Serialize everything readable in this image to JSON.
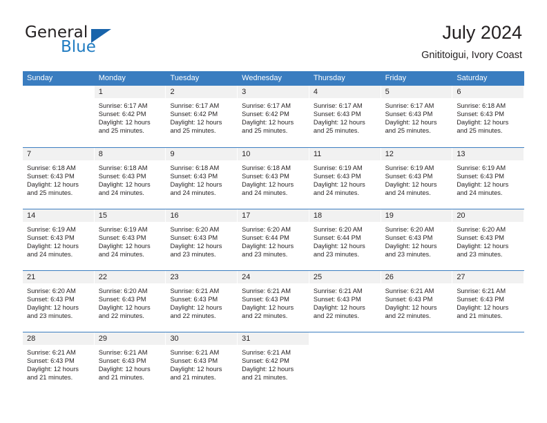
{
  "brand": {
    "word_general": "General",
    "word_blue": "Blue",
    "triangle_color": "#1864ab",
    "blue_color": "#1f7bc1"
  },
  "header": {
    "title": "July 2024",
    "subtitle": "Gnititoigui, Ivory Coast"
  },
  "theme": {
    "header_band": "#3a7dc0",
    "day_head_bg": "#f1f1f1",
    "text": "#231f20"
  },
  "weekday_headers": [
    "Sunday",
    "Monday",
    "Tuesday",
    "Wednesday",
    "Thursday",
    "Friday",
    "Saturday"
  ],
  "weeks": [
    [
      {
        "day": "",
        "lines": []
      },
      {
        "day": "1",
        "lines": [
          "Sunrise: 6:17 AM",
          "Sunset: 6:42 PM",
          "Daylight: 12 hours",
          "and 25 minutes."
        ]
      },
      {
        "day": "2",
        "lines": [
          "Sunrise: 6:17 AM",
          "Sunset: 6:42 PM",
          "Daylight: 12 hours",
          "and 25 minutes."
        ]
      },
      {
        "day": "3",
        "lines": [
          "Sunrise: 6:17 AM",
          "Sunset: 6:42 PM",
          "Daylight: 12 hours",
          "and 25 minutes."
        ]
      },
      {
        "day": "4",
        "lines": [
          "Sunrise: 6:17 AM",
          "Sunset: 6:43 PM",
          "Daylight: 12 hours",
          "and 25 minutes."
        ]
      },
      {
        "day": "5",
        "lines": [
          "Sunrise: 6:17 AM",
          "Sunset: 6:43 PM",
          "Daylight: 12 hours",
          "and 25 minutes."
        ]
      },
      {
        "day": "6",
        "lines": [
          "Sunrise: 6:18 AM",
          "Sunset: 6:43 PM",
          "Daylight: 12 hours",
          "and 25 minutes."
        ]
      }
    ],
    [
      {
        "day": "7",
        "lines": [
          "Sunrise: 6:18 AM",
          "Sunset: 6:43 PM",
          "Daylight: 12 hours",
          "and 25 minutes."
        ]
      },
      {
        "day": "8",
        "lines": [
          "Sunrise: 6:18 AM",
          "Sunset: 6:43 PM",
          "Daylight: 12 hours",
          "and 24 minutes."
        ]
      },
      {
        "day": "9",
        "lines": [
          "Sunrise: 6:18 AM",
          "Sunset: 6:43 PM",
          "Daylight: 12 hours",
          "and 24 minutes."
        ]
      },
      {
        "day": "10",
        "lines": [
          "Sunrise: 6:18 AM",
          "Sunset: 6:43 PM",
          "Daylight: 12 hours",
          "and 24 minutes."
        ]
      },
      {
        "day": "11",
        "lines": [
          "Sunrise: 6:19 AM",
          "Sunset: 6:43 PM",
          "Daylight: 12 hours",
          "and 24 minutes."
        ]
      },
      {
        "day": "12",
        "lines": [
          "Sunrise: 6:19 AM",
          "Sunset: 6:43 PM",
          "Daylight: 12 hours",
          "and 24 minutes."
        ]
      },
      {
        "day": "13",
        "lines": [
          "Sunrise: 6:19 AM",
          "Sunset: 6:43 PM",
          "Daylight: 12 hours",
          "and 24 minutes."
        ]
      }
    ],
    [
      {
        "day": "14",
        "lines": [
          "Sunrise: 6:19 AM",
          "Sunset: 6:43 PM",
          "Daylight: 12 hours",
          "and 24 minutes."
        ]
      },
      {
        "day": "15",
        "lines": [
          "Sunrise: 6:19 AM",
          "Sunset: 6:43 PM",
          "Daylight: 12 hours",
          "and 24 minutes."
        ]
      },
      {
        "day": "16",
        "lines": [
          "Sunrise: 6:20 AM",
          "Sunset: 6:43 PM",
          "Daylight: 12 hours",
          "and 23 minutes."
        ]
      },
      {
        "day": "17",
        "lines": [
          "Sunrise: 6:20 AM",
          "Sunset: 6:44 PM",
          "Daylight: 12 hours",
          "and 23 minutes."
        ]
      },
      {
        "day": "18",
        "lines": [
          "Sunrise: 6:20 AM",
          "Sunset: 6:44 PM",
          "Daylight: 12 hours",
          "and 23 minutes."
        ]
      },
      {
        "day": "19",
        "lines": [
          "Sunrise: 6:20 AM",
          "Sunset: 6:43 PM",
          "Daylight: 12 hours",
          "and 23 minutes."
        ]
      },
      {
        "day": "20",
        "lines": [
          "Sunrise: 6:20 AM",
          "Sunset: 6:43 PM",
          "Daylight: 12 hours",
          "and 23 minutes."
        ]
      }
    ],
    [
      {
        "day": "21",
        "lines": [
          "Sunrise: 6:20 AM",
          "Sunset: 6:43 PM",
          "Daylight: 12 hours",
          "and 23 minutes."
        ]
      },
      {
        "day": "22",
        "lines": [
          "Sunrise: 6:20 AM",
          "Sunset: 6:43 PM",
          "Daylight: 12 hours",
          "and 22 minutes."
        ]
      },
      {
        "day": "23",
        "lines": [
          "Sunrise: 6:21 AM",
          "Sunset: 6:43 PM",
          "Daylight: 12 hours",
          "and 22 minutes."
        ]
      },
      {
        "day": "24",
        "lines": [
          "Sunrise: 6:21 AM",
          "Sunset: 6:43 PM",
          "Daylight: 12 hours",
          "and 22 minutes."
        ]
      },
      {
        "day": "25",
        "lines": [
          "Sunrise: 6:21 AM",
          "Sunset: 6:43 PM",
          "Daylight: 12 hours",
          "and 22 minutes."
        ]
      },
      {
        "day": "26",
        "lines": [
          "Sunrise: 6:21 AM",
          "Sunset: 6:43 PM",
          "Daylight: 12 hours",
          "and 22 minutes."
        ]
      },
      {
        "day": "27",
        "lines": [
          "Sunrise: 6:21 AM",
          "Sunset: 6:43 PM",
          "Daylight: 12 hours",
          "and 21 minutes."
        ]
      }
    ],
    [
      {
        "day": "28",
        "lines": [
          "Sunrise: 6:21 AM",
          "Sunset: 6:43 PM",
          "Daylight: 12 hours",
          "and 21 minutes."
        ]
      },
      {
        "day": "29",
        "lines": [
          "Sunrise: 6:21 AM",
          "Sunset: 6:43 PM",
          "Daylight: 12 hours",
          "and 21 minutes."
        ]
      },
      {
        "day": "30",
        "lines": [
          "Sunrise: 6:21 AM",
          "Sunset: 6:43 PM",
          "Daylight: 12 hours",
          "and 21 minutes."
        ]
      },
      {
        "day": "31",
        "lines": [
          "Sunrise: 6:21 AM",
          "Sunset: 6:42 PM",
          "Daylight: 12 hours",
          "and 21 minutes."
        ]
      },
      {
        "day": "",
        "lines": []
      },
      {
        "day": "",
        "lines": []
      },
      {
        "day": "",
        "lines": []
      }
    ]
  ]
}
